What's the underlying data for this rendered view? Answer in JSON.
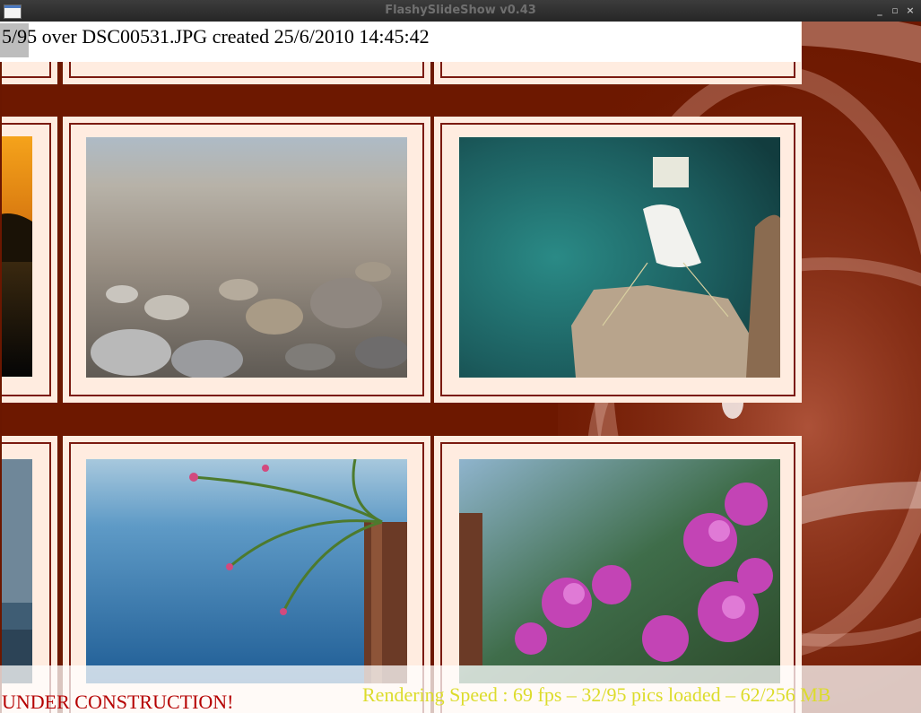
{
  "window": {
    "title": "FlashySlideShow v0.43",
    "buttons": {
      "minimize": "_",
      "maximize": "▫",
      "close": "×"
    }
  },
  "slideshow": {
    "info_text": "5/95 over DSC00531.JPG created 25/6/2010 14:45:42",
    "under_construction": "UNDER CONSTRUCTION!",
    "render_stats": "Rendering Speed : 69 fps  – 32/95 pics loaded – 62/256 MB"
  },
  "colors": {
    "background": "#6d1800",
    "frame": "#ffece0",
    "frame_border": "#7b1a10",
    "under_construction_text": "#b50000",
    "stats_text": "#dcdc2c"
  },
  "photos": [
    {
      "name": "sunset-photo"
    },
    {
      "name": "pebbles-photo"
    },
    {
      "name": "boat-photo"
    },
    {
      "name": "sea-left-photo"
    },
    {
      "name": "plant-pot-photo"
    },
    {
      "name": "bougainvillea-photo"
    }
  ]
}
